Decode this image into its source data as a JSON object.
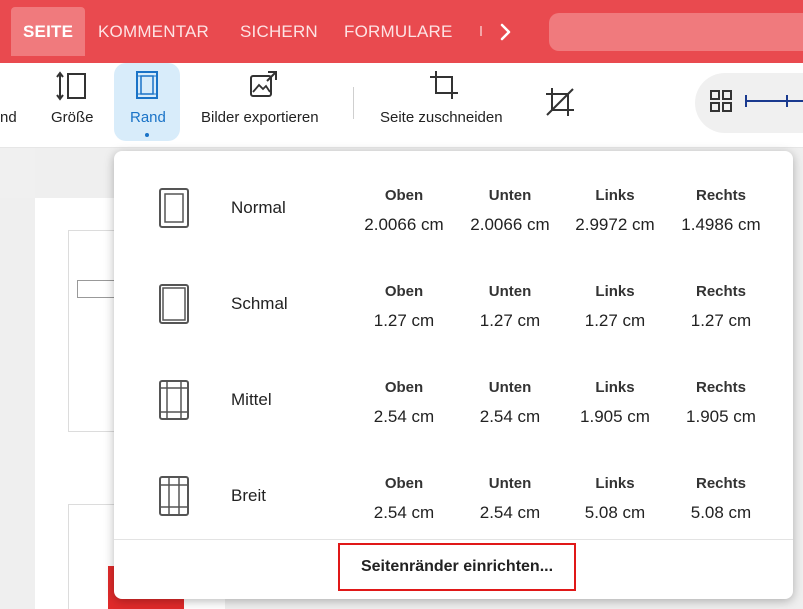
{
  "tabs": [
    {
      "label": "SEITE",
      "active": true
    },
    {
      "label": "KOMMENTAR"
    },
    {
      "label": "SICHERN"
    },
    {
      "label": "FORMULARE"
    }
  ],
  "ribbon": {
    "partial_label": "nd",
    "size_label": "Größe",
    "rand_label": "Rand",
    "export_label": "Bilder exportieren",
    "crop_page_label": "Seite zuschneiden"
  },
  "margins_menu": {
    "presets": [
      {
        "name": "Normal",
        "headers": [
          "Oben",
          "Unten",
          "Links",
          "Rechts"
        ],
        "values": [
          "2.0066 cm",
          "2.0066 cm",
          "2.9972 cm",
          "1.4986 cm"
        ],
        "icon": "margin-normal-icon"
      },
      {
        "name": "Schmal",
        "headers": [
          "Oben",
          "Unten",
          "Links",
          "Rechts"
        ],
        "values": [
          "1.27 cm",
          "1.27 cm",
          "1.27 cm",
          "1.27 cm"
        ],
        "icon": "margin-narrow-icon"
      },
      {
        "name": "Mittel",
        "headers": [
          "Oben",
          "Unten",
          "Links",
          "Rechts"
        ],
        "values": [
          "2.54 cm",
          "2.54 cm",
          "1.905 cm",
          "1.905 cm"
        ],
        "icon": "margin-medium-icon"
      },
      {
        "name": "Breit",
        "headers": [
          "Oben",
          "Unten",
          "Links",
          "Rechts"
        ],
        "values": [
          "2.54 cm",
          "2.54 cm",
          "5.08 cm",
          "5.08 cm"
        ],
        "icon": "margin-wide-icon"
      }
    ],
    "custom_label": "Seitenränder einrichten..."
  },
  "colors": {
    "brand_red": "#e94a4f",
    "active_blue": "#1a73c7",
    "highlight_border": "#e01818"
  }
}
